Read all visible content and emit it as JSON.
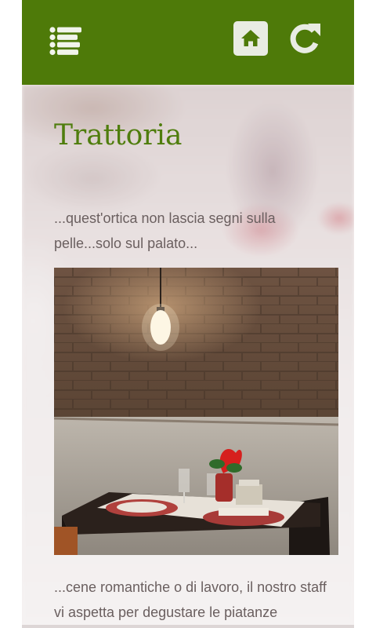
{
  "header": {
    "background_color": "#4e7a09",
    "menu_icon": "list-menu-icon",
    "home_icon": "home-icon",
    "refresh_icon": "refresh-icon"
  },
  "main": {
    "title": "Trattoria",
    "title_color": "#4f7d0d",
    "intro_text": "...quest'ortica non lascia segni sulla pelle...solo sul palato...",
    "photo": "restaurant-table-photo",
    "body_text": "...cene romantiche o di lavoro, il nostro staff vi aspetta per degustare le piatanze"
  }
}
